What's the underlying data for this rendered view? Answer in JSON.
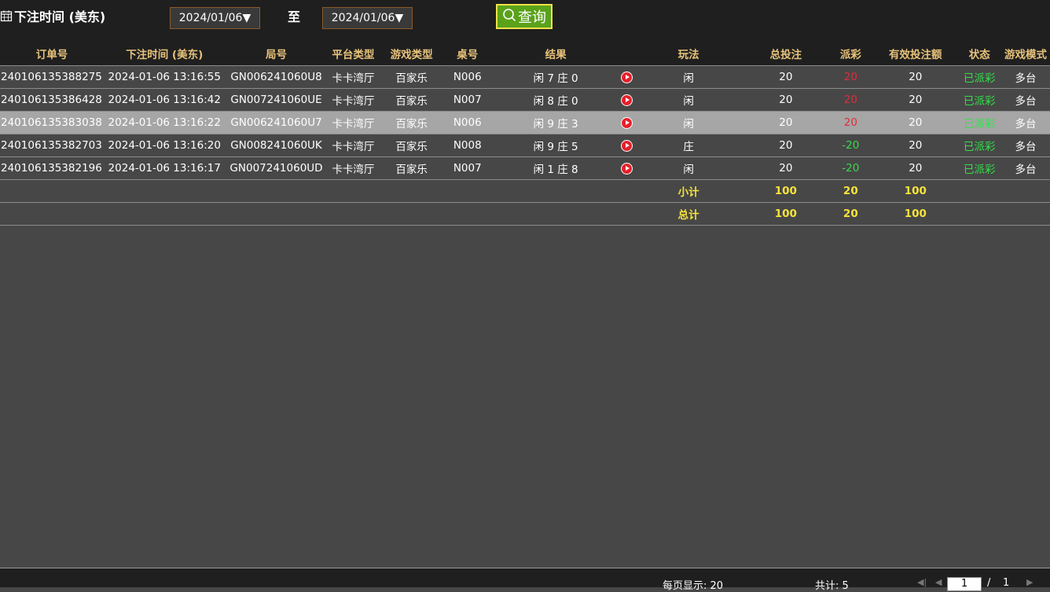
{
  "filter": {
    "label": "下注时间 (美东)",
    "from_date": "2024/01/06▼",
    "to_label": "至",
    "to_date": "2024/01/06▼",
    "query_label": "查询"
  },
  "columns": [
    "订单号",
    "下注时间 (美东)",
    "局号",
    "平台类型",
    "游戏类型",
    "桌号",
    "结果",
    "",
    "玩法",
    "总投注",
    "派彩",
    "有效投注额",
    "状态",
    "游戏模式"
  ],
  "rows": [
    {
      "order": "240106135388275",
      "time": "2024-01-06 13:16:55",
      "round": "GN006241060U8",
      "platform": "卡卡湾厅",
      "game": "百家乐",
      "table": "N006",
      "result": "闲 7 庄 0",
      "play": "闲",
      "bet": "20",
      "payout": "20",
      "valid": "20",
      "status": "已派彩",
      "mode": "多台",
      "payout_color": "#e02b3a"
    },
    {
      "order": "240106135386428",
      "time": "2024-01-06 13:16:42",
      "round": "GN007241060UE",
      "platform": "卡卡湾厅",
      "game": "百家乐",
      "table": "N007",
      "result": "闲 8 庄 0",
      "play": "闲",
      "bet": "20",
      "payout": "20",
      "valid": "20",
      "status": "已派彩",
      "mode": "多台",
      "payout_color": "#e02b3a"
    },
    {
      "order": "240106135383038",
      "time": "2024-01-06 13:16:22",
      "round": "GN006241060U7",
      "platform": "卡卡湾厅",
      "game": "百家乐",
      "table": "N006",
      "result": "闲 9 庄 3",
      "play": "闲",
      "bet": "20",
      "payout": "20",
      "valid": "20",
      "status": "已派彩",
      "mode": "多台",
      "payout_color": "#e02b3a"
    },
    {
      "order": "240106135382703",
      "time": "2024-01-06 13:16:20",
      "round": "GN008241060UK",
      "platform": "卡卡湾厅",
      "game": "百家乐",
      "table": "N008",
      "result": "闲 9 庄 5",
      "play": "庄",
      "bet": "20",
      "payout": "-20",
      "valid": "20",
      "status": "已派彩",
      "mode": "多台",
      "payout_color": "#38d94a"
    },
    {
      "order": "240106135382196",
      "time": "2024-01-06 13:16:17",
      "round": "GN007241060UD",
      "platform": "卡卡湾厅",
      "game": "百家乐",
      "table": "N007",
      "result": "闲 1 庄 8",
      "play": "闲",
      "bet": "20",
      "payout": "-20",
      "valid": "20",
      "status": "已派彩",
      "mode": "多台",
      "payout_color": "#38d94a"
    }
  ],
  "subtotal": {
    "label": "小计",
    "bet": "100",
    "payout": "20",
    "valid": "100"
  },
  "total": {
    "label": "总计",
    "bet": "100",
    "payout": "20",
    "valid": "100"
  },
  "footer": {
    "page_size": "每页显示: 20",
    "count": "共计: 5",
    "page": "1",
    "page_sep": "/",
    "page_total": "1"
  },
  "colors": {
    "header_text": "#e7c27a",
    "summary_text": "#f5e33b",
    "status_green": "#33e04a",
    "selected_row": "#a6a6a6",
    "query_button": "#5aa21a"
  }
}
